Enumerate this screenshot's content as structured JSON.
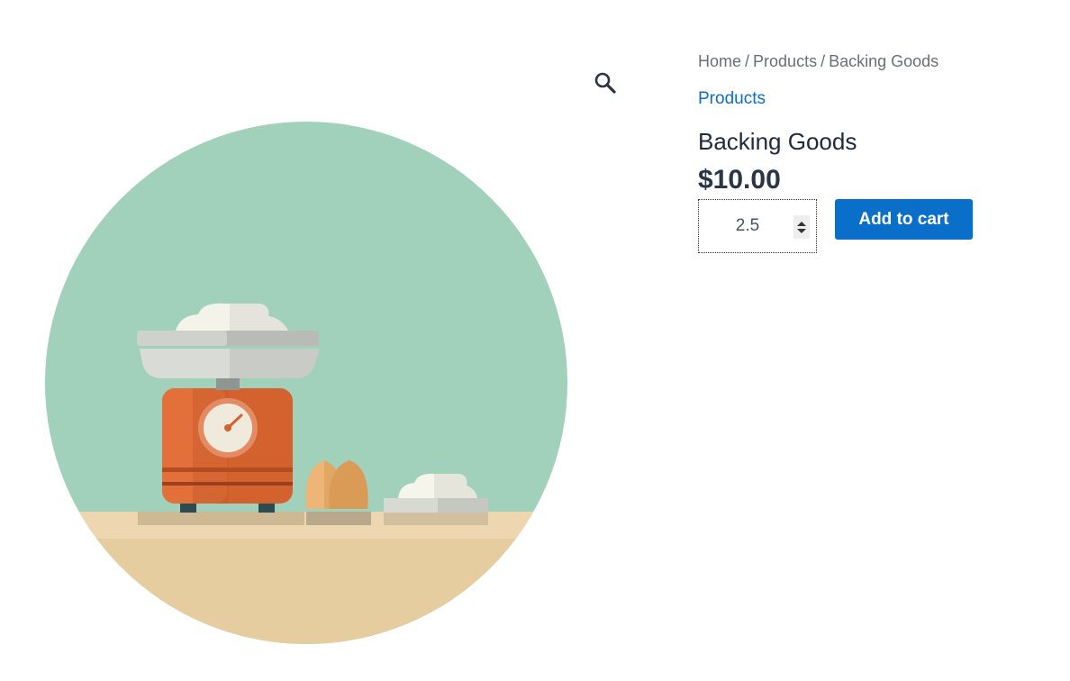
{
  "gallery": {
    "zoom_icon": "magnifier-icon",
    "image_subject": "kitchen scale, eggs and flour illustration"
  },
  "breadcrumb": {
    "items": [
      "Home",
      "Products",
      "Backing Goods"
    ],
    "separator": "/"
  },
  "product": {
    "category": "Products",
    "title": "Backing Goods",
    "price": "$10.00"
  },
  "cart": {
    "quantity": "2.5",
    "add_to_cart_label": "Add to cart"
  },
  "colors": {
    "accent": "#0a6fc9",
    "title": "#1f2a3d",
    "price": "#2a3547",
    "muted": "#6b6f75"
  }
}
